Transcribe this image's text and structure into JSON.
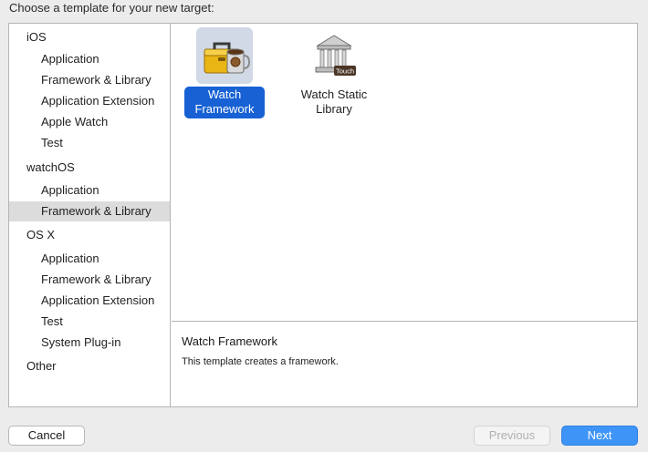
{
  "dialog": {
    "header": "Choose a template for your new target:"
  },
  "sidebar": {
    "groups": [
      {
        "platform": "iOS",
        "items": [
          "Application",
          "Framework & Library",
          "Application Extension",
          "Apple Watch",
          "Test"
        ]
      },
      {
        "platform": "watchOS",
        "items": [
          "Application",
          "Framework & Library"
        ],
        "selected_item": "Framework & Library"
      },
      {
        "platform": "OS X",
        "items": [
          "Application",
          "Framework & Library",
          "Application Extension",
          "Test",
          "System Plug-in"
        ]
      },
      {
        "platform": "Other",
        "items": []
      }
    ]
  },
  "templates": [
    {
      "label": "Watch Framework",
      "icon": "toolbox-coffee-icon",
      "selected": true
    },
    {
      "label": "Watch Static Library",
      "icon": "library-building-icon",
      "badge": "Touch",
      "selected": false
    }
  ],
  "description": {
    "title": "Watch Framework",
    "text": "This template creates a framework."
  },
  "buttons": {
    "cancel": "Cancel",
    "previous": "Previous",
    "next": "Next",
    "previous_enabled": false
  },
  "colors": {
    "accent": "#1761d4",
    "next_button": "#3f95f7",
    "sidebar_selection": "#dcdcdc"
  }
}
